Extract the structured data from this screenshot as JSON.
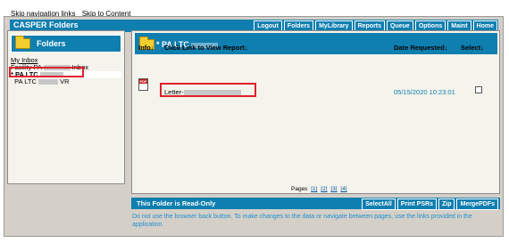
{
  "skip_links": [
    "Skip navigation links",
    "Skip to Content"
  ],
  "app": {
    "title": "CASPER Folders"
  },
  "top_nav": [
    "Logout",
    "Folders",
    "MyLibrary",
    "Reports",
    "Queue",
    "Options",
    "Maint",
    "Home"
  ],
  "left_panel": {
    "title": "Folders",
    "items": [
      {
        "label": "My Inbox"
      },
      {
        "label_prefix": "Facility PA",
        "label_suffix": "Inbox"
      },
      {
        "label_prefix": "* PA LTC",
        "selected": true
      },
      {
        "label_prefix": "PA LTC",
        "label_suffix": "VR"
      }
    ]
  },
  "right_panel": {
    "title": "* PA LTC",
    "columns": {
      "info": "Info↓",
      "link": "Click Link to View Report↓",
      "date": "Date Requested↓",
      "select": "Select↓"
    },
    "rows": [
      {
        "icon": "pdf-icon",
        "report": "Letter-",
        "date": "05/15/2020 10:23:01",
        "selected": false
      }
    ],
    "pages_label": "Pages",
    "pages": [
      "[1]",
      "[2]",
      "[3]",
      "[4]"
    ]
  },
  "footer": {
    "status": "This Folder is Read-Only",
    "buttons": [
      "SelectAll",
      "Print PSRs",
      "Zip",
      "MergePDFs"
    ],
    "note": "Do not use the browser back button. To make changes to the data or navigate between pages, use the links provided in the application."
  },
  "colors": {
    "accent": "#0f7fb0",
    "highlight": "#e0202a",
    "panel_bg": "#f4f3ec",
    "frame_bg": "#d4d0c8"
  }
}
